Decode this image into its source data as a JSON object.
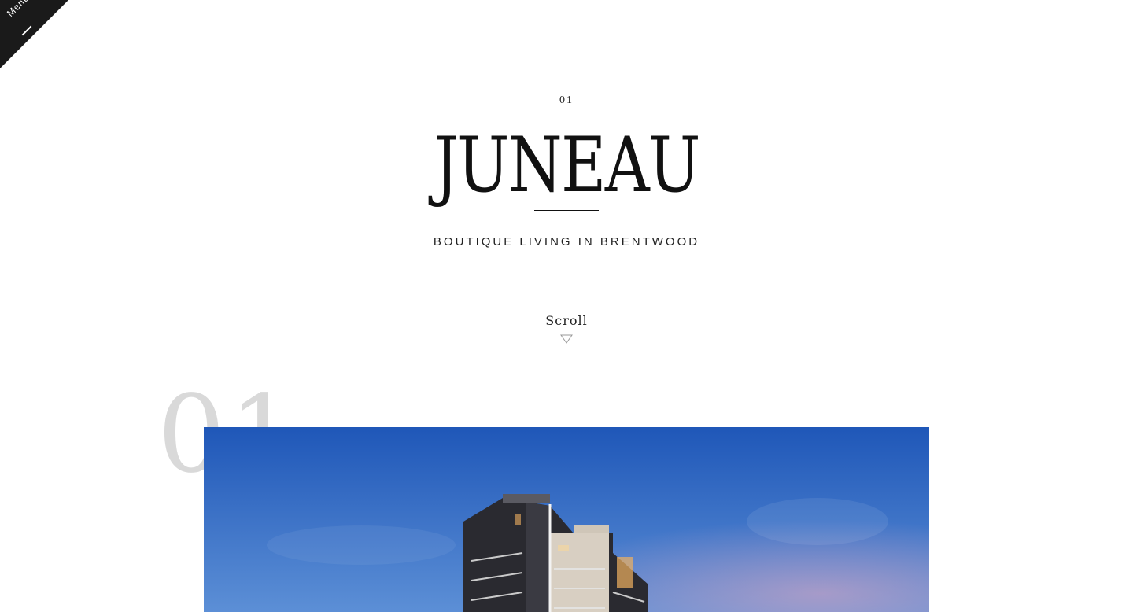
{
  "menu": {
    "label": "Menu"
  },
  "hero": {
    "index": "01",
    "title": "JUNEAU",
    "subtitle": "BOUTIQUE LIVING IN BRENTWOOD",
    "scroll_label": "Scroll"
  },
  "section": {
    "number": "01",
    "image_alt": "building rendering at dusk"
  },
  "colors": {
    "menu_bg": "#1a1a1a",
    "sky_top": "#1f57b8",
    "sky_bottom": "#5c8fd6",
    "section_number": "#d9d9d9"
  }
}
